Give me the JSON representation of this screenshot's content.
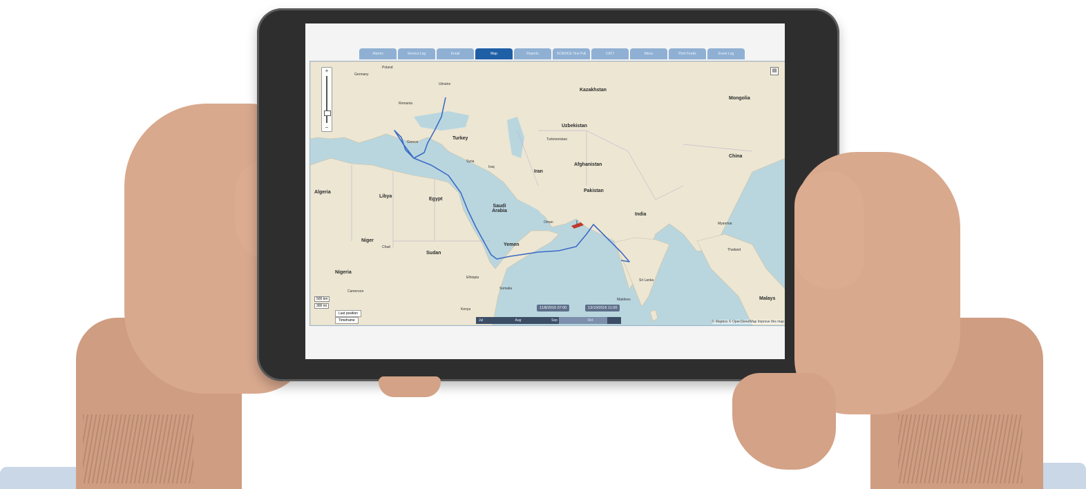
{
  "tabs": [
    {
      "label": "Alarms"
    },
    {
      "label": "Service Log"
    },
    {
      "label": "Email"
    },
    {
      "label": "Map"
    },
    {
      "label": "Reports"
    },
    {
      "label": "SCIENCE One Pull"
    },
    {
      "label": "CAT7"
    },
    {
      "label": "Menu"
    },
    {
      "label": "Print Feeds"
    },
    {
      "label": "Event Log"
    }
  ],
  "active_tab": "Map",
  "map": {
    "labels": {
      "kazakhstan": "Kazakhstan",
      "mongolia": "Mongolia",
      "ukraine": "Ukraine",
      "poland": "Poland",
      "germany": "Germany",
      "romania": "Romania",
      "turkey": "Turkey",
      "uzbekistan": "Uzbekistan",
      "turkmenistan": "Turkmenistan",
      "afghanistan": "Afghanistan",
      "iran": "Iran",
      "iraq": "Iraq",
      "syria": "Syria",
      "china": "China",
      "pakistan": "Pakistan",
      "india": "India",
      "algeria": "Algeria",
      "libya": "Libya",
      "egypt": "Egypt",
      "saudi_arabia": "Saudi Arabia",
      "oman": "Oman",
      "yemen": "Yemen",
      "niger": "Niger",
      "chad": "Chad",
      "sudan": "Sudan",
      "nigeria": "Nigeria",
      "ethiopia": "Ethiopia",
      "somalia": "Somalia",
      "kenya": "Kenya",
      "myanmar": "Myanmar",
      "thailand": "Thailand",
      "sri_lanka": "Sri Lanka",
      "maldives": "Maldives",
      "malaysia": "Malays",
      "cameroon": "Cameroon",
      "greece": "Greece"
    },
    "scale": [
      "500 km",
      "300 mi"
    ],
    "controls": {
      "last_position": "Last position",
      "timeframe": "Timeframe"
    },
    "timeline": {
      "months": [
        "Jul",
        "Aug",
        "Sep",
        "Oct"
      ],
      "start": "11/8/2016 07:00",
      "end": "13/10/2016 11:00"
    },
    "attribution": "© Mapbox © OpenStreetMap Improve this map"
  },
  "colors": {
    "route": "#3b6bc4",
    "active_tab": "#1f5fa6",
    "inactive_tab": "#8fb0d3",
    "sea": "#b9d6df",
    "land": "#ece6d3"
  }
}
